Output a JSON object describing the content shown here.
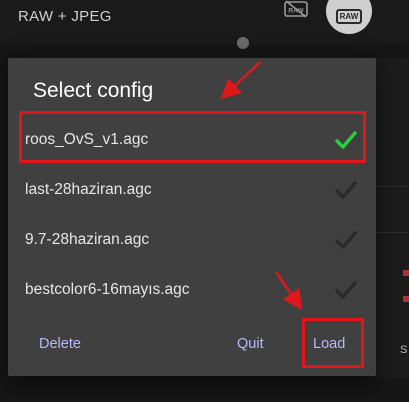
{
  "topbar": {
    "mode_label": "RAW + JPEG",
    "raw_off_icon": "raw-off-icon",
    "raw_toggle_icon": "raw-icon",
    "raw_badge_text": "RAW"
  },
  "background": {
    "right_text": "S"
  },
  "dialog": {
    "title": "Select config",
    "items": [
      {
        "name": "roos_OvS_v1.agc",
        "selected": true
      },
      {
        "name": "last-28haziran.agc",
        "selected": false
      },
      {
        "name": "9.7-28haziran.agc",
        "selected": false
      },
      {
        "name": "bestcolor6-16mayıs.agc",
        "selected": false
      }
    ],
    "actions": {
      "delete": "Delete",
      "quit": "Quit",
      "load": "Load"
    }
  },
  "colors": {
    "dialog_bg": "#404040",
    "check_selected": "#2ecc40",
    "check_unselected": "#2a2a2a",
    "accent_text": "#b8b8ff",
    "annotation_red": "#e0161b"
  }
}
